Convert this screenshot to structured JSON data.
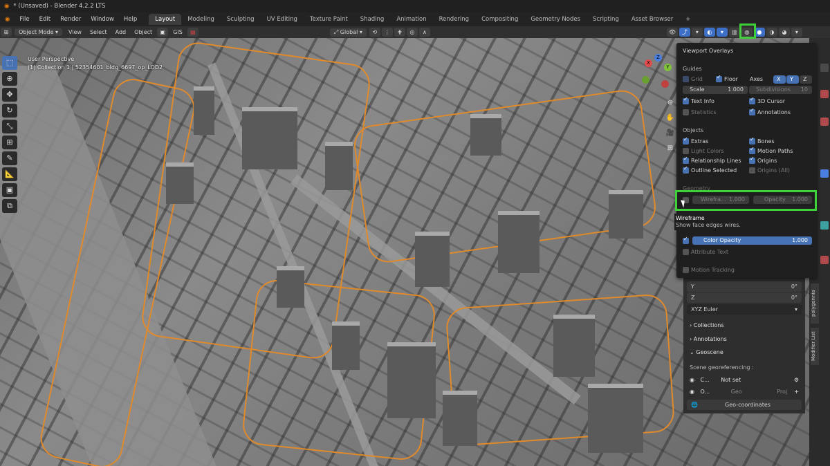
{
  "window": {
    "title": "* (Unsaved) - Blender 4.2.2 LTS"
  },
  "menu": {
    "items": [
      "File",
      "Edit",
      "Render",
      "Window",
      "Help"
    ],
    "workspaces": [
      "Layout",
      "Modeling",
      "Sculpting",
      "UV Editing",
      "Texture Paint",
      "Shading",
      "Animation",
      "Rendering",
      "Compositing",
      "Geometry Nodes",
      "Scripting",
      "Asset Browser"
    ],
    "active_workspace": "Layout",
    "add_tab": "+"
  },
  "toolbar": {
    "mode": "Object Mode",
    "items": [
      "View",
      "Select",
      "Add",
      "Object"
    ],
    "gis": "GIS",
    "orientation": "Global"
  },
  "viewport": {
    "perspective": "User Perspective",
    "active_object": "(1) Collection 1 | 52354601_bldg_6697_op_LOD2",
    "gizmo_axes": [
      "X",
      "Y",
      "Z"
    ]
  },
  "overlays_panel": {
    "title": "Viewport Overlays",
    "guides": {
      "header": "Guides",
      "grid": {
        "label": "Grid",
        "checked": true
      },
      "floor": {
        "label": "Floor",
        "checked": true
      },
      "axes_label": "Axes",
      "axes": [
        "X",
        "Y",
        "Z"
      ],
      "scale": {
        "label": "Scale",
        "value": "1.000"
      },
      "subdivisions": {
        "label": "Subdivisions",
        "value": "10"
      },
      "text_info": {
        "label": "Text Info",
        "checked": true
      },
      "cursor_3d": {
        "label": "3D Cursor",
        "checked": true
      },
      "statistics": {
        "label": "Statistics",
        "checked": false
      },
      "annotations": {
        "label": "Annotations",
        "checked": true
      }
    },
    "objects": {
      "header": "Objects",
      "extras": {
        "label": "Extras",
        "checked": true
      },
      "bones": {
        "label": "Bones",
        "checked": true
      },
      "light_colors": {
        "label": "Light Colors",
        "checked": false
      },
      "motion_paths": {
        "label": "Motion Paths",
        "checked": true
      },
      "relationship_lines": {
        "label": "Relationship Lines",
        "checked": true
      },
      "origins": {
        "label": "Origins",
        "checked": true
      },
      "outline_selected": {
        "label": "Outline Selected",
        "checked": true
      },
      "origins_all": {
        "label": "Origins (All)",
        "checked": false
      }
    },
    "geometry": {
      "header": "Geometry",
      "wireframe": {
        "label": "Wirefra...",
        "value": "1.000",
        "checked": false
      },
      "opacity": {
        "label": "Opacity",
        "value": "1.000"
      },
      "color_opacity": {
        "label": "Color Opacity",
        "value": "1.000",
        "checked": true
      },
      "attribute_text": {
        "label": "Attribute Text",
        "checked": false
      },
      "motion_tracking": {
        "label": "Motion Tracking",
        "checked": false
      }
    }
  },
  "tooltip": {
    "title": "Wireframe",
    "description": "Show face edges wires."
  },
  "n_panel": {
    "y": {
      "label": "Y",
      "value": "0°"
    },
    "z": {
      "label": "Z",
      "value": "0°"
    },
    "rotation_mode": "XYZ Euler",
    "collections": "Collections",
    "annotations": "Annotations",
    "geoscene": "Geoscene",
    "scene_georef": "Scene georeferencing :",
    "crs_short": "C...",
    "crs_value": "Not set",
    "origin_short": "O...",
    "geo_btn": "Geo",
    "proj_btn": "Proj",
    "geo_coords": "Geo-coordinates"
  },
  "side_tabs": [
    "polygonnia",
    "Modifier List"
  ],
  "colors": {
    "accent": "#4772b3",
    "highlight": "#3ed13a",
    "outline": "#e08a2c"
  }
}
